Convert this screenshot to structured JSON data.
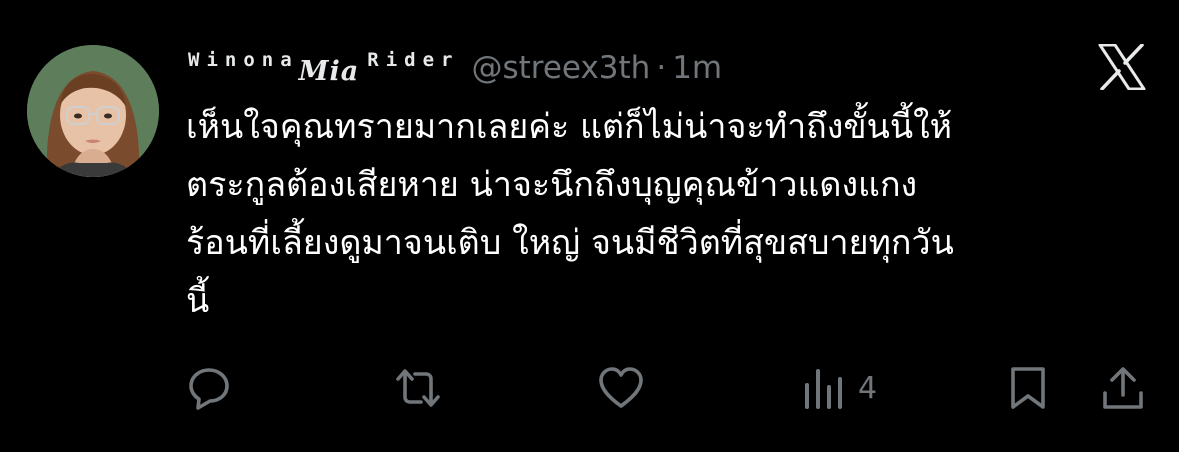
{
  "tweet": {
    "display_name_part1": "Winona",
    "display_name_part2": "Mia",
    "display_name_part3": "Rider",
    "handle": "@streex3th",
    "separator": "·",
    "time": "1m",
    "text_lines": [
      "เห็นใจคุณทรายมากเลยค่ะ แต่ก็ไม่น่าจะทำถึงขั้นนี้ให้",
      "ตระกูลต้องเสียหาย น่าจะนึกถึงบุญคุณข้าวแดงแกง",
      "ร้อนที่เลี้ยงดูมาจนเติบ ใหญ่ จนมีชีวิตที่สุขสบายทุกวัน",
      "นี้"
    ],
    "views_count": "4"
  },
  "icons": {
    "brand": "x-logo-icon",
    "reply": "reply-icon",
    "retweet": "retweet-icon",
    "like": "heart-icon",
    "views": "views-icon",
    "bookmark": "bookmark-icon",
    "share": "share-icon"
  },
  "colors": {
    "background": "#000000",
    "text": "#ffffff",
    "secondary": "#71767b"
  }
}
